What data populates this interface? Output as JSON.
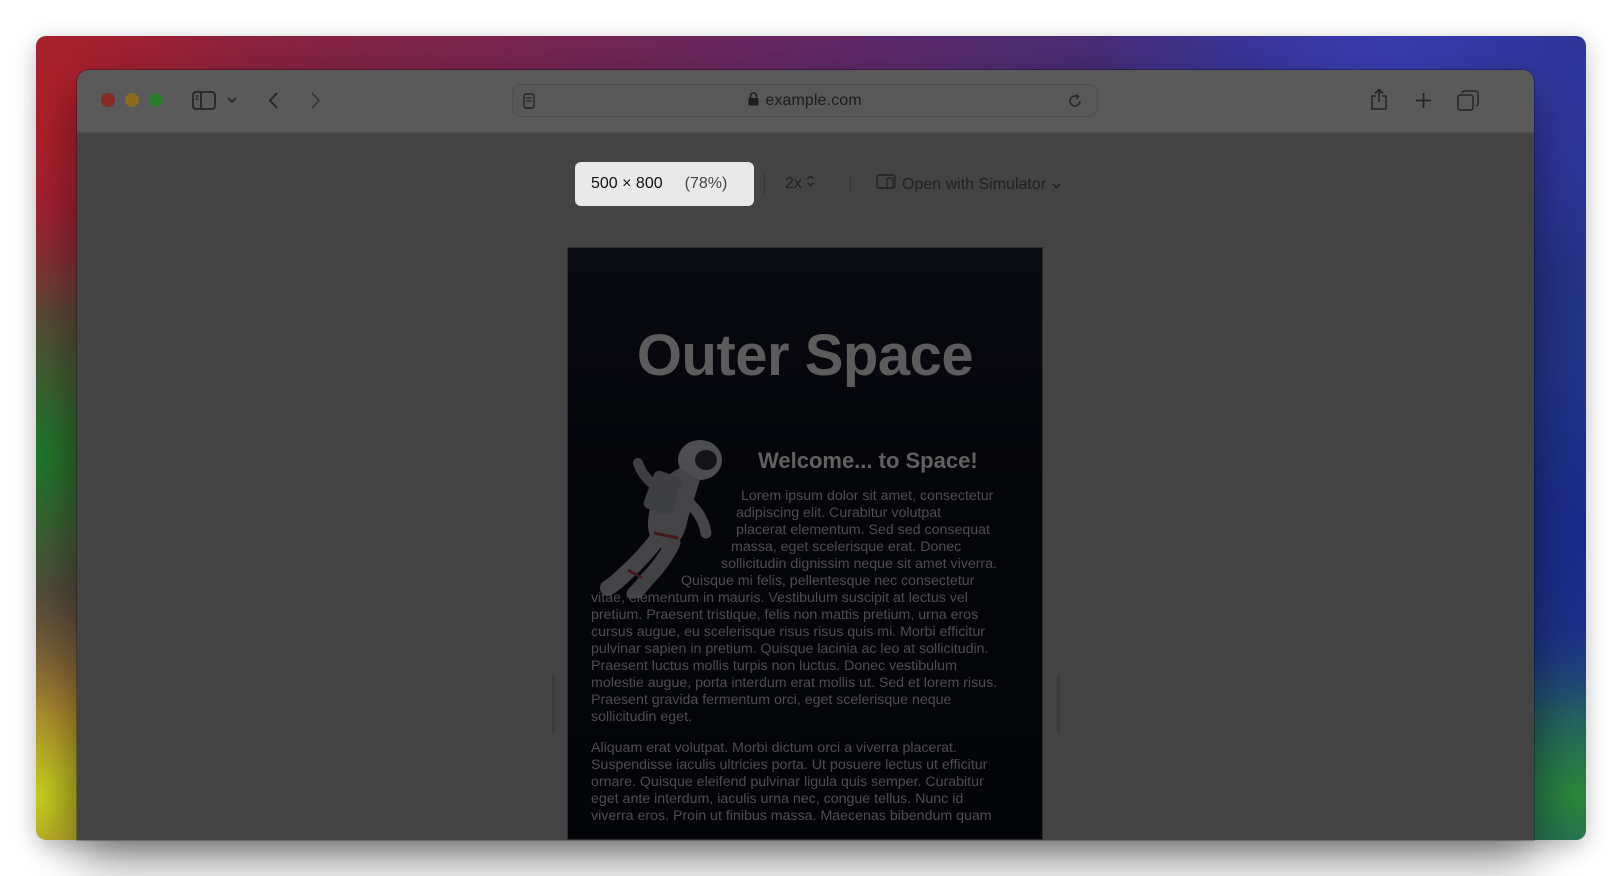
{
  "browser": {
    "url": "example.com",
    "icons": [
      "sidebar-icon",
      "chevron-down-icon",
      "back-icon",
      "forward-icon",
      "page-icon",
      "lock-icon",
      "reload-icon",
      "share-icon",
      "new-tab-icon",
      "tabs-overview-icon"
    ]
  },
  "responsive_toolbar": {
    "dimensions": "500 × 800",
    "zoom": "(78%)",
    "scale": "2x",
    "simulator_label": "Open with Simulator"
  },
  "page": {
    "title": "Outer Space",
    "heading": "Welcome... to Space!",
    "paragraph1_lines": [
      "Lorem ipsum dolor sit amet, consectetur",
      "adipiscing elit. Curabitur volutpat",
      "placerat elementum. Sed sed consequat",
      "massa, eget scelerisque erat. Donec",
      "sollicitudin dignissim neque sit amet viverra.",
      "Quisque mi felis, pellentesque nec consectetur",
      "vitae, elementum in mauris. Vestibulum suscipit at lectus vel",
      "pretium. Praesent tristique, felis non mattis pretium, urna eros",
      "cursus augue, eu scelerisque risus risus quis mi. Morbi efficitur",
      "pulvinar sapien in pretium. Quisque lacinia ac leo at sollicitudin.",
      "Praesent luctus mollis turpis non luctus. Donec vestibulum",
      "molestie augue, porta interdum erat mollis ut. Sed et lorem risus.",
      "Praesent gravida fermentum orci, eget scelerisque neque",
      "sollicitudin eget."
    ],
    "paragraph2_lines": [
      "Aliquam erat volutpat. Morbi dictum orci a viverra placerat.",
      "Suspendisse iaculis ultricies porta. Ut posuere lectus ut efficitur",
      "ornare. Quisque eleifend pulvinar ligula quis semper. Curabitur",
      "eget ante interdum, iaculis urna nec, congue tellus. Nunc id",
      "viverra eros. Proin ut finibus massa. Maecenas bibendum quam"
    ]
  }
}
